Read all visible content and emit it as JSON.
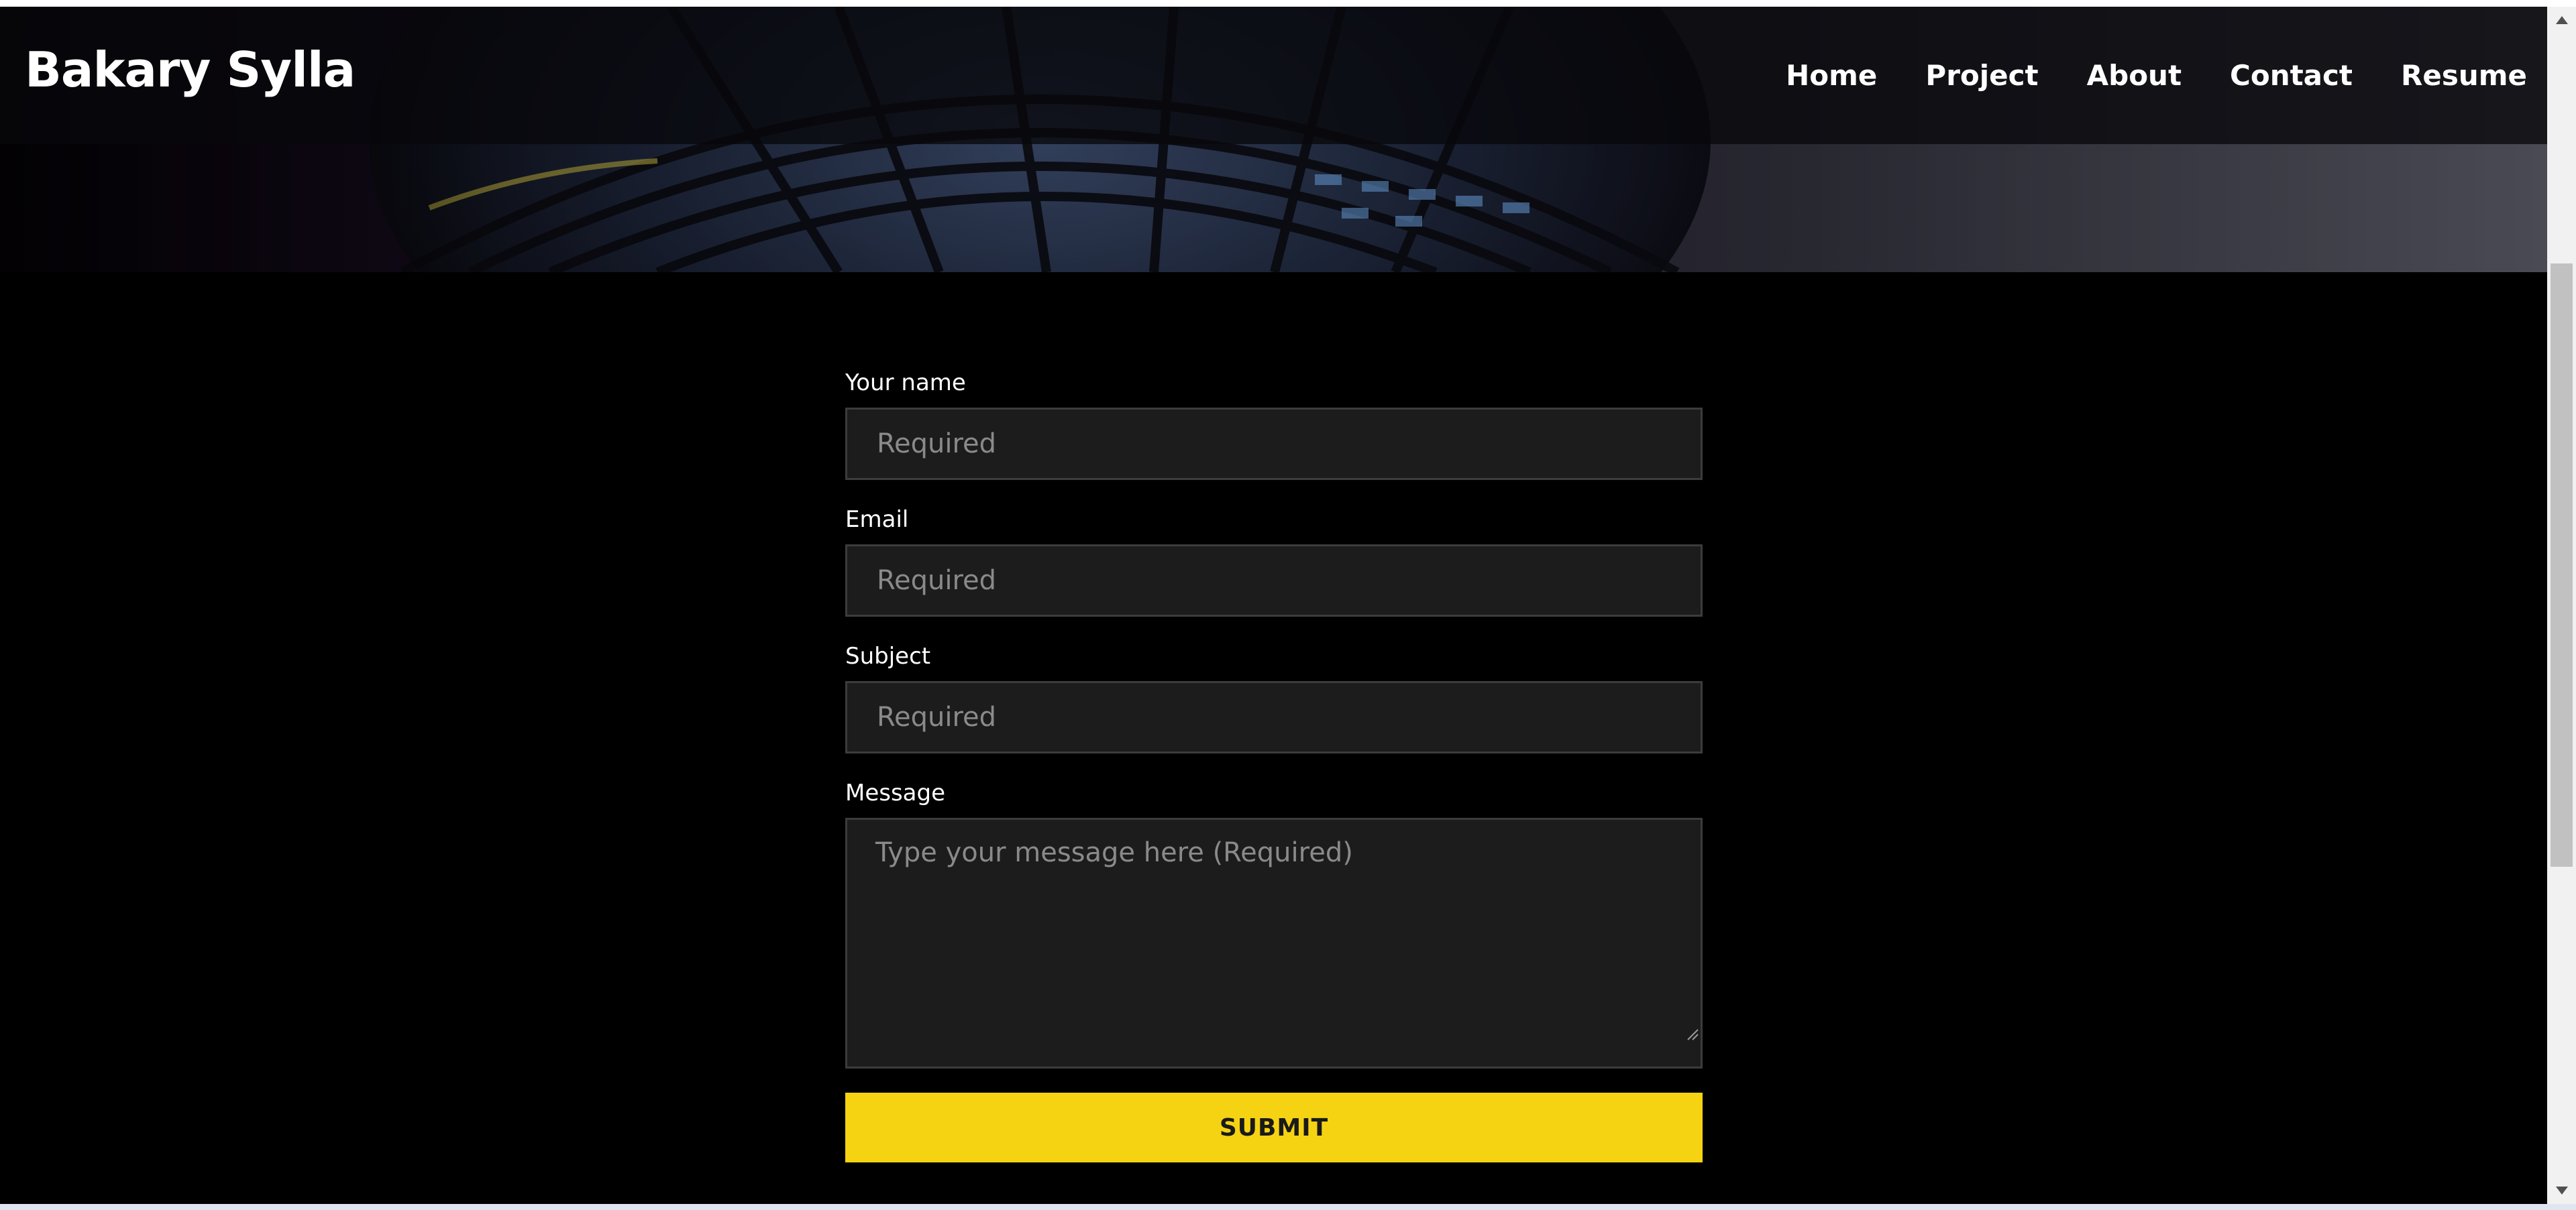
{
  "header": {
    "brand": "Bakary Sylla",
    "nav": [
      "Home",
      "Project",
      "About",
      "Contact",
      "Resume"
    ]
  },
  "form": {
    "name_label": "Your name",
    "name_placeholder": "Required",
    "email_label": "Email",
    "email_placeholder": "Required",
    "subject_label": "Subject",
    "subject_placeholder": "Required",
    "message_label": "Message",
    "message_placeholder": "Type your message here (Required)",
    "submit_label": "SUBMIT"
  },
  "colors": {
    "background": "#000000",
    "field_background": "#1c1c1c",
    "accent": "#f5d312"
  },
  "icons": {
    "scroll_up": "triangle-up-icon",
    "scroll_down": "triangle-down-icon",
    "resize": "resize-grip-icon"
  }
}
